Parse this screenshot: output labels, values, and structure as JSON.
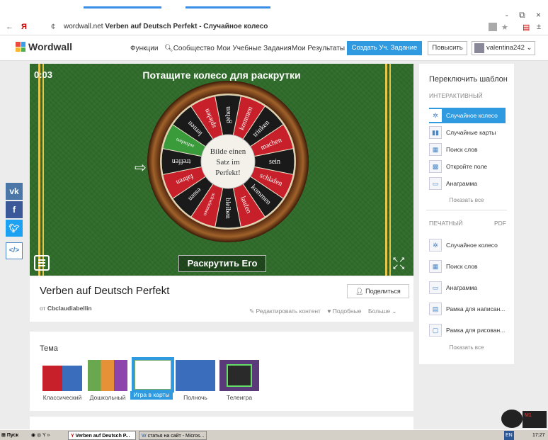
{
  "browser": {
    "back": "←",
    "menu_letter": "Я",
    "domain": "wordwall.net",
    "page_title": "Verben auf Deutsch Perfekt - Случайное колесо",
    "window_controls": "- ⧉ ×"
  },
  "header": {
    "logo": "Wordwall",
    "nav": [
      "Функции",
      "Сообщество",
      "Мои Учебные Задания",
      "Мои Результаты"
    ],
    "create_button": "Создать Уч. Задание",
    "upgrade_button": "Повысить",
    "user": "valentina242",
    "colors": {
      "accent": "#2f9ae0"
    }
  },
  "game": {
    "timer": "0:03",
    "instruction": "Потащите колесо для раскрутки",
    "center_text": [
      "Bilde einen",
      "Satz im",
      "Perfekt!"
    ],
    "segments": [
      "sein",
      "schlafen",
      "kommen",
      "laufen",
      "bleiben",
      "schwimmen",
      "essen",
      "fahren",
      "treffen",
      "aufstehen",
      "lernen",
      "spielen",
      "gehen",
      "kommen",
      "trinken",
      "machen"
    ],
    "spin_button": "Раскрутить Его",
    "colors": {
      "red": "#c8202b",
      "black": "#1a1a1a",
      "green": "#3a9b3a",
      "felt": "#2f6b2a"
    }
  },
  "social": [
    "vk",
    "f",
    "twitter",
    "</>"
  ],
  "activity": {
    "title": "Verben auf Deutsch Perfekt",
    "author_prefix": "от",
    "author": "Cbclaudiabellin",
    "share_button": "Поделиться",
    "edit": "Редактировать контент",
    "like": "Подобные",
    "more": "Больше"
  },
  "theme": {
    "title": "Тема",
    "options": [
      "Классический",
      "Дошкольный",
      "Игра в карты",
      "Полночь",
      "Телеигра"
    ],
    "selected": "Игра в карты"
  },
  "panel": {
    "title": "Переключить шаблон",
    "interactive_label": "ИНТЕРАКТИВНЫЙ",
    "interactive": [
      "Случайное колесо",
      "Случайные карты",
      "Поиск слов",
      "Откройте поле",
      "Анаграмма"
    ],
    "show_all": "Показать все",
    "print_label": "ПЕЧАТНЫЙ",
    "pdf_label": "PDF",
    "printable": [
      "Случайное колесо",
      "Поиск слов",
      "Анаграмма",
      "Рамка для написан...",
      "Рамка для рисован..."
    ]
  },
  "taskbar": {
    "start": "Пуск",
    "tasks": [
      "Verben auf Deutsch P...",
      "статья на сайт - Micros..."
    ],
    "lang": "EN",
    "clock": "17:27"
  }
}
